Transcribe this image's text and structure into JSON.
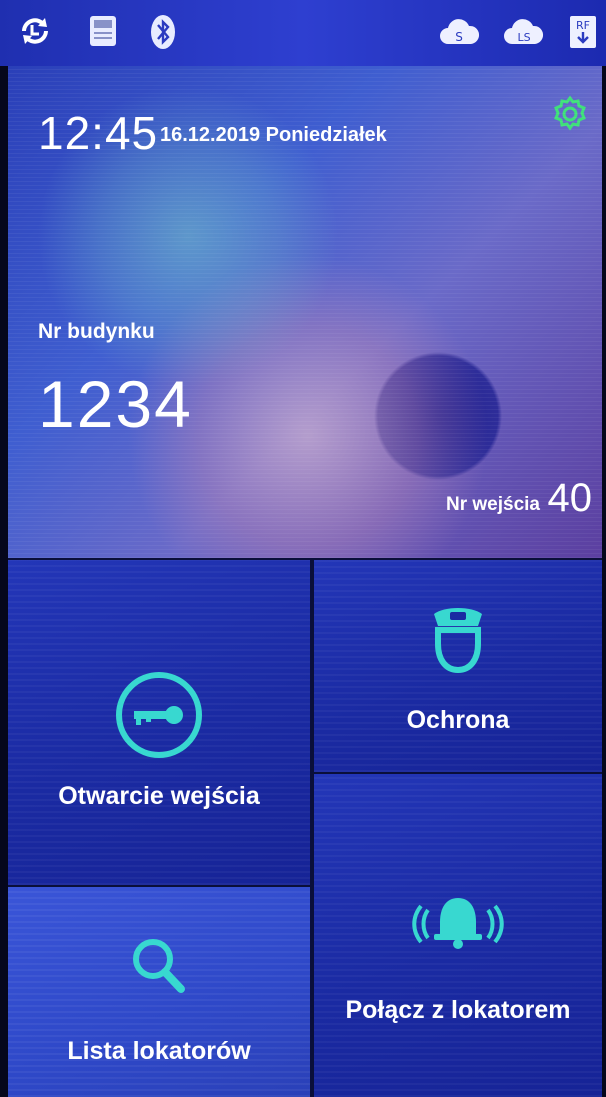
{
  "status_bar": {
    "icons": [
      "sync-icon",
      "sd-card-icon",
      "bluetooth-icon",
      "cloud-s-icon",
      "cloud-ls-icon",
      "rf-download-icon"
    ],
    "cloud_s_text": "S",
    "cloud_ls_text": "LS",
    "rf_text": "RF"
  },
  "header": {
    "time": "12:45",
    "date": "16.12.2019 Poniedziałek",
    "building_label": "Nr budynku",
    "building_number": "1234",
    "entrance_label": "Nr wejścia",
    "entrance_number": "40"
  },
  "tiles": {
    "open_entrance": "Otwarcie wejścia",
    "security": "Ochrona",
    "tenant_list": "Lista lokatorów",
    "call_tenant": "Połącz z lokatorem"
  },
  "colors": {
    "accent": "#38d8d0",
    "gear": "#3ee07a"
  }
}
